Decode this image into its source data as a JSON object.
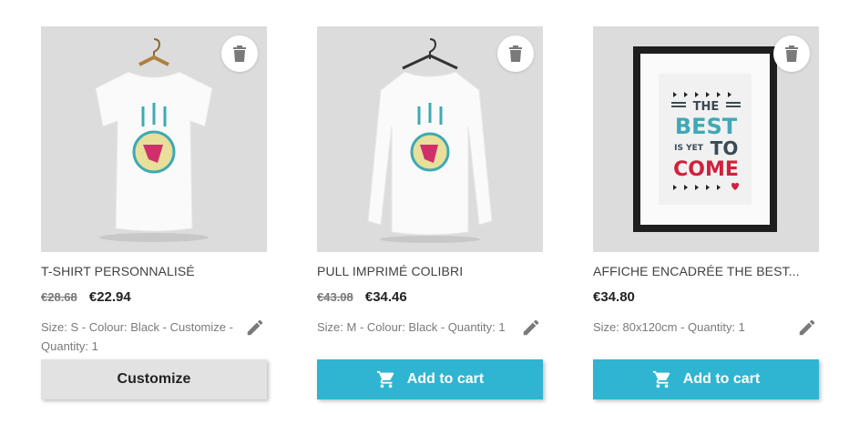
{
  "products": [
    {
      "name": "T-SHIRT PERSONNALISÉ",
      "old_price": "€28.68",
      "price": "€22.94",
      "attributes": "Size: S - Colour: Black - Customize - Quantity: 1",
      "button_label": "Customize"
    },
    {
      "name": "PULL IMPRIMÉ COLIBRI",
      "old_price": "€43.08",
      "price": "€34.46",
      "attributes": "Size: M - Colour: Black - Quantity: 1",
      "button_label": "Add to cart"
    },
    {
      "name": "AFFICHE ENCADRÉE THE BEST...",
      "old_price": "",
      "price": "€34.80",
      "attributes": "Size: 80x120cm - Quantity: 1",
      "button_label": "Add to cart"
    }
  ],
  "poster": {
    "line1": "THE",
    "line2": "BEST",
    "line3a": "IS YET",
    "line3b": "TO",
    "line4": "COME"
  },
  "colors": {
    "accent": "#2fb5d2",
    "button_grey": "#e2e2e2",
    "poster_teal": "#3fa9b5",
    "poster_red": "#d0213c"
  },
  "icons": {
    "delete": "trash-icon",
    "edit": "pencil-icon",
    "cart": "cart-icon"
  }
}
